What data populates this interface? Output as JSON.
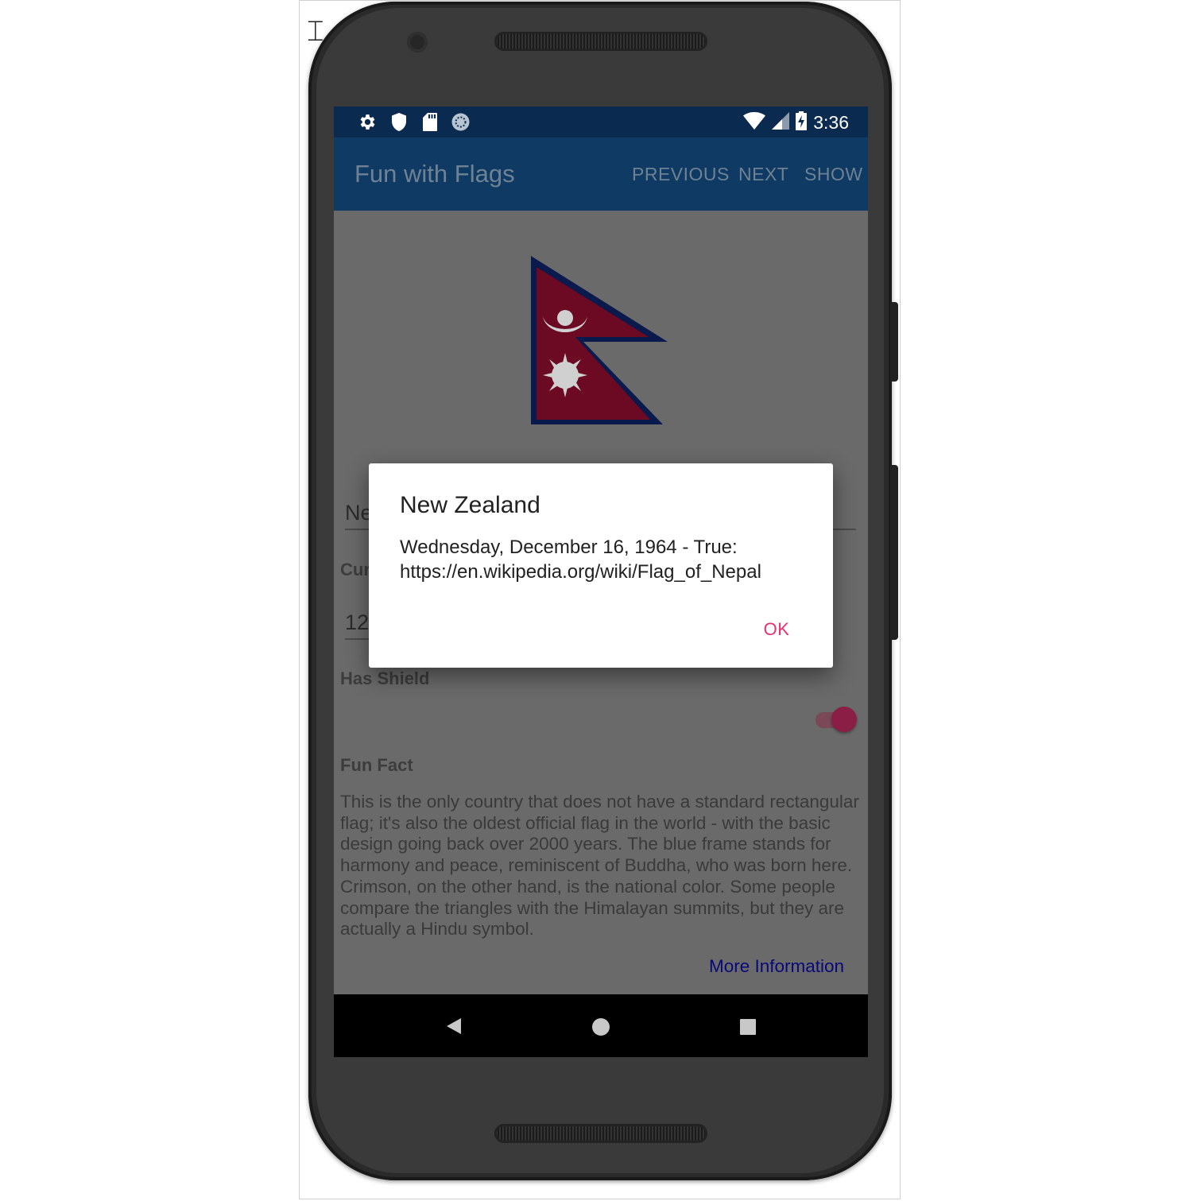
{
  "status_bar": {
    "time": "3:36",
    "left_icons": [
      "settings-icon",
      "shield-icon",
      "sd-card-icon",
      "sync-icon"
    ],
    "right_icons": [
      "wifi-icon",
      "signal-icon",
      "battery-charging-icon"
    ]
  },
  "app_bar": {
    "title": "Fun with Flags",
    "actions": [
      "PREVIOUS",
      "NEXT",
      "SHOW"
    ]
  },
  "form": {
    "name_value_partial": "Ne",
    "currency_label_partial": "Cur",
    "number_value_partial": "12",
    "has_shield_label": "Has Shield",
    "has_shield_on": true,
    "fun_fact_label": "Fun Fact",
    "fun_fact_text": "This is the only country that does not have a standard rectangular flag; it's also the oldest official flag in the world - with the basic design going back over 2000 years. The blue frame stands for harmony and peace, reminiscent of Buddha, who was born here. Crimson, on the other hand, is the national color. Some people compare the triangles with the Himalayan summits, but they are actually a Hindu symbol.",
    "more_info_link": "More Information"
  },
  "dialog": {
    "title": "New Zealand",
    "message_line1": "Wednesday, December 16, 1964 - True:",
    "message_line2": "https://en.wikipedia.org/wiki/Flag_of_Nepal",
    "ok_label": "OK"
  },
  "colors": {
    "status_bar": "#0a2b4f",
    "app_bar": "#0e3a63",
    "accent": "#e8306f",
    "flag_crimson": "#6b0a22",
    "flag_blue": "#0b1a4d"
  }
}
